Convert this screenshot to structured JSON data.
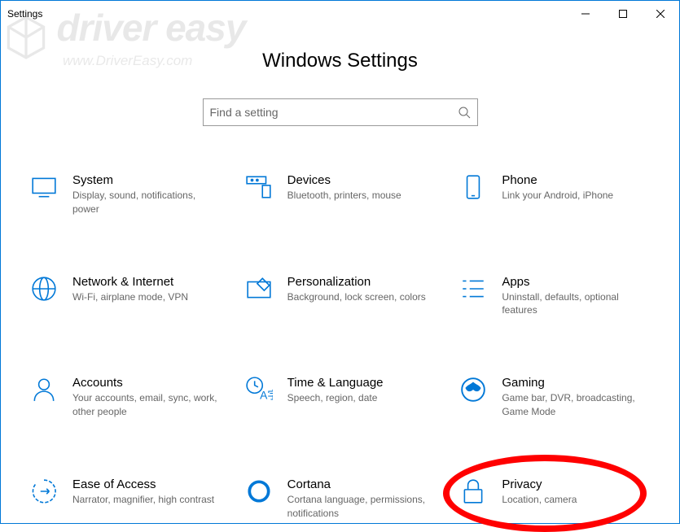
{
  "window": {
    "title": "Settings"
  },
  "page": {
    "title": "Windows Settings"
  },
  "search": {
    "placeholder": "Find a setting"
  },
  "categories": [
    {
      "title": "System",
      "desc": "Display, sound, notifications, power",
      "icon": "system"
    },
    {
      "title": "Devices",
      "desc": "Bluetooth, printers, mouse",
      "icon": "devices"
    },
    {
      "title": "Phone",
      "desc": "Link your Android, iPhone",
      "icon": "phone"
    },
    {
      "title": "Network & Internet",
      "desc": "Wi-Fi, airplane mode, VPN",
      "icon": "network"
    },
    {
      "title": "Personalization",
      "desc": "Background, lock screen, colors",
      "icon": "personalization"
    },
    {
      "title": "Apps",
      "desc": "Uninstall, defaults, optional features",
      "icon": "apps"
    },
    {
      "title": "Accounts",
      "desc": "Your accounts, email, sync, work, other people",
      "icon": "accounts"
    },
    {
      "title": "Time & Language",
      "desc": "Speech, region, date",
      "icon": "time"
    },
    {
      "title": "Gaming",
      "desc": "Game bar, DVR, broadcasting, Game Mode",
      "icon": "gaming"
    },
    {
      "title": "Ease of Access",
      "desc": "Narrator, magnifier, high contrast",
      "icon": "ease"
    },
    {
      "title": "Cortana",
      "desc": "Cortana language, permissions, notifications",
      "icon": "cortana"
    },
    {
      "title": "Privacy",
      "desc": "Location, camera",
      "icon": "privacy",
      "highlighted": true
    }
  ],
  "watermark": {
    "brand": "driver easy",
    "url": "www.DriverEasy.com"
  }
}
